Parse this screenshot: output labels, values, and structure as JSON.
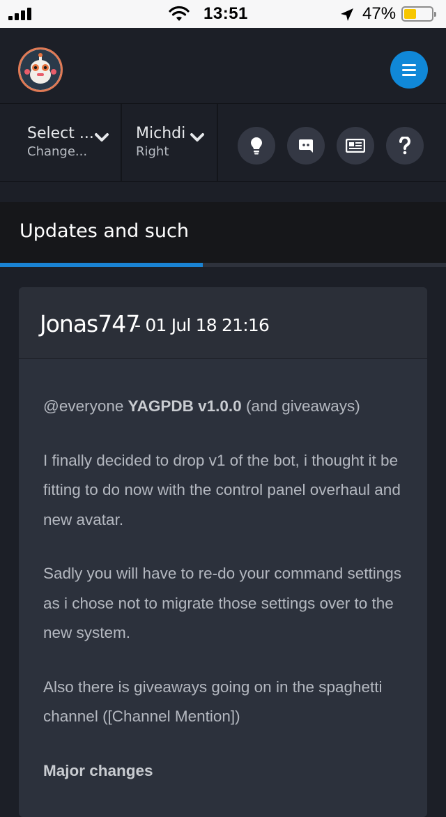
{
  "status_bar": {
    "time": "13:51",
    "battery_percent": "47%",
    "battery_level": 0.47
  },
  "header": {
    "logo_icon": "bot-avatar-icon",
    "menu_icon": "hamburger-menu-icon",
    "menu_button_color": "#1088d8"
  },
  "toolbar": {
    "server_select": {
      "label": "Select ...",
      "sublabel": "Change..."
    },
    "user_select": {
      "label": "Michdi",
      "sublabel": "Right"
    },
    "icon_buttons": [
      "lightbulb-icon",
      "discord-icon",
      "news-icon",
      "help-icon"
    ]
  },
  "section": {
    "title": "Updates and such",
    "progress": 0.455,
    "accent_color": "#1a83d3"
  },
  "post": {
    "author": "Jonas747",
    "separator": "-",
    "date": "01 Jul 18 21:16",
    "intro_prefix": "@everyone",
    "intro_bold": "YAGPDB v1.0.0",
    "intro_suffix": "(and giveaways)",
    "paragraph1": "I finally decided to drop v1 of the bot, i thought it be fitting to do now with the control panel overhaul and new avatar.",
    "paragraph2": "Sadly you will have to re-do your command settings as i chose not to migrate those settings over to the new system.",
    "paragraph3": "Also there is giveaways going on in the spaghetti channel ([Channel Mention])",
    "heading": "Major changes"
  }
}
